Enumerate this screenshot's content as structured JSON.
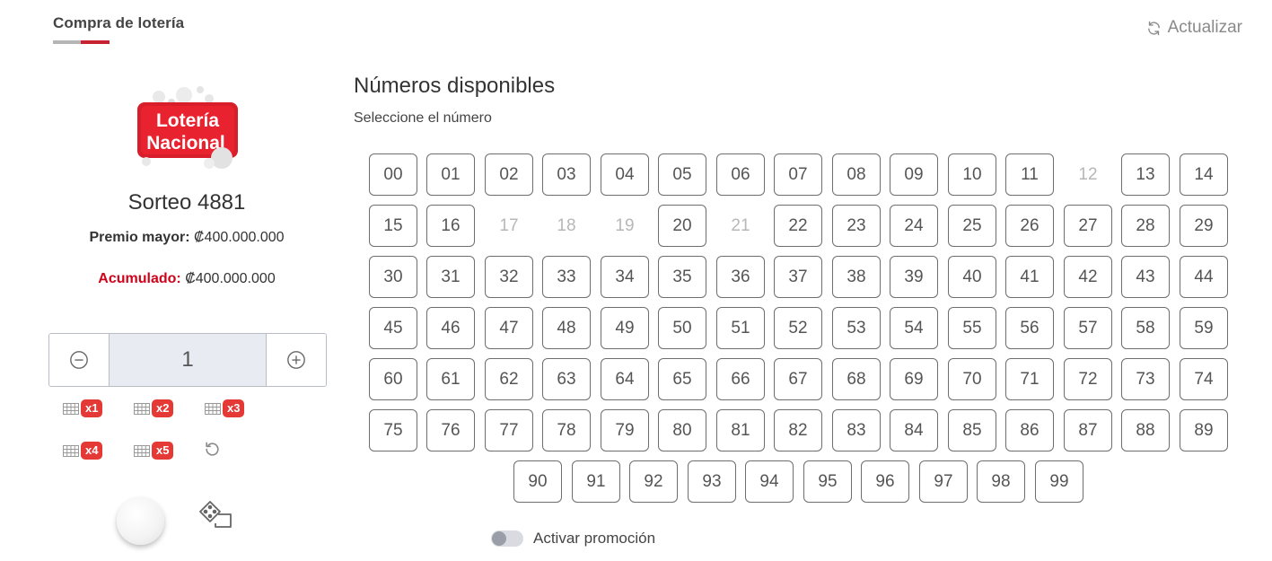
{
  "header": {
    "tab_title": "Compra de lotería",
    "refresh_label": "Actualizar",
    "accent_color": "#c62330"
  },
  "draw": {
    "logo_text_line1": "Lotería",
    "logo_text_line2": "Nacional",
    "sorteo": "Sorteo 4881",
    "premio_label": "Premio mayor:",
    "premio_value": "₡400.000.000",
    "acumulado_label": "Acumulado:",
    "acumulado_value": "₡400.000.000"
  },
  "stepper": {
    "value": "1",
    "minus_icon": "minus-circle-icon",
    "plus_icon": "plus-circle-icon"
  },
  "multipliers": [
    "x1",
    "x2",
    "x3",
    "x4",
    "x5"
  ],
  "numbers_section": {
    "title": "Números disponibles",
    "subtitle": "Seleccione el número",
    "numbers": [
      "00",
      "01",
      "02",
      "03",
      "04",
      "05",
      "06",
      "07",
      "08",
      "09",
      "10",
      "11",
      "12",
      "13",
      "14",
      "15",
      "16",
      "17",
      "18",
      "19",
      "20",
      "21",
      "22",
      "23",
      "24",
      "25",
      "26",
      "27",
      "28",
      "29",
      "30",
      "31",
      "32",
      "33",
      "34",
      "35",
      "36",
      "37",
      "38",
      "39",
      "40",
      "41",
      "42",
      "43",
      "44",
      "45",
      "46",
      "47",
      "48",
      "49",
      "50",
      "51",
      "52",
      "53",
      "54",
      "55",
      "56",
      "57",
      "58",
      "59",
      "60",
      "61",
      "62",
      "63",
      "64",
      "65",
      "66",
      "67",
      "68",
      "69",
      "70",
      "71",
      "72",
      "73",
      "74",
      "75",
      "76",
      "77",
      "78",
      "79",
      "80",
      "81",
      "82",
      "83",
      "84",
      "85",
      "86",
      "87",
      "88",
      "89",
      "90",
      "91",
      "92",
      "93",
      "94",
      "95",
      "96",
      "97",
      "98",
      "99"
    ],
    "unavailable": [
      "12",
      "17",
      "18",
      "19",
      "21"
    ]
  },
  "promotion": {
    "label": "Activar promoción",
    "enabled": false
  }
}
